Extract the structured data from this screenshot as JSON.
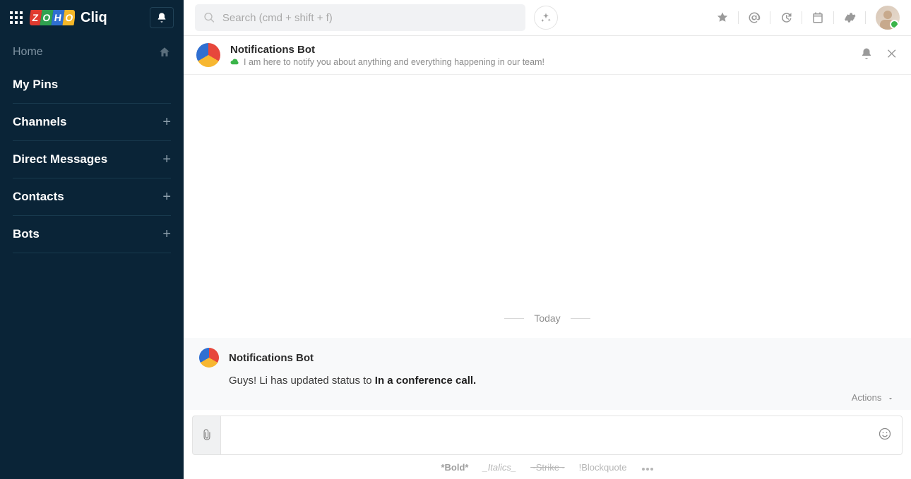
{
  "search": {
    "placeholder": "Search (cmd + shift + f)"
  },
  "sidebar": {
    "home": "Home",
    "items": [
      {
        "label": "My Pins",
        "plus": false
      },
      {
        "label": "Channels",
        "plus": true
      },
      {
        "label": "Direct Messages",
        "plus": true
      },
      {
        "label": "Contacts",
        "plus": true
      },
      {
        "label": "Bots",
        "plus": true
      }
    ]
  },
  "chat_header": {
    "title": "Notifications Bot",
    "subtitle": "I am here to notify you about anything and everything happening in our team!"
  },
  "date_divider": "Today",
  "message": {
    "sender": "Notifications Bot",
    "body_prefix": "Guys! Li has updated status to ",
    "body_accent": "In a conference call.",
    "actions_label": "Actions"
  },
  "format_hints": {
    "bold": "*Bold*",
    "italics": "_Italics_",
    "strike": "~Strike~",
    "blockquote": "!Blockquote"
  }
}
